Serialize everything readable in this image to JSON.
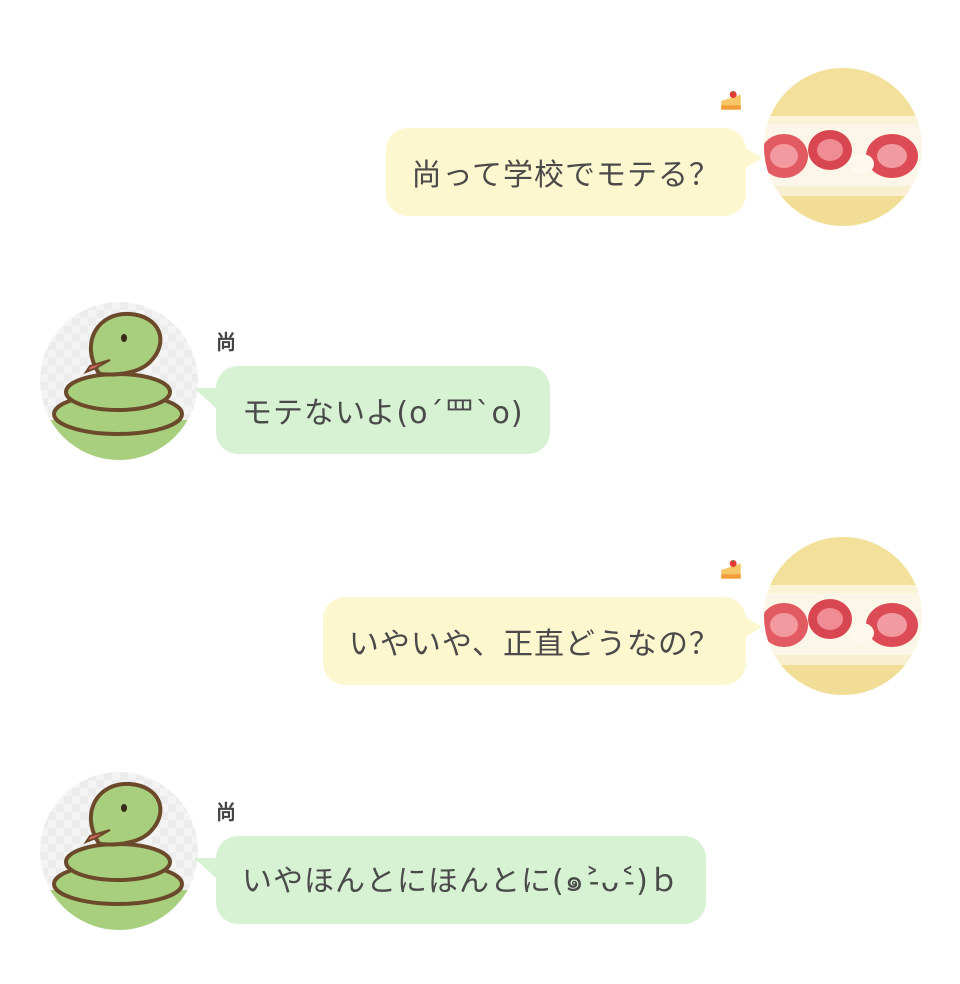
{
  "chat": {
    "messages": [
      {
        "direction": "outgoing",
        "text": "尚って学校でモテる？",
        "status_icon": "cake-icon"
      },
      {
        "direction": "incoming",
        "sender": "尚",
        "text": "モテないよ(o´罒`o)"
      },
      {
        "direction": "outgoing",
        "text": "いやいや、正直どうなの？",
        "status_icon": "cake-icon"
      },
      {
        "direction": "incoming",
        "sender": "尚",
        "text": "いやほんとにほんとに(๑˃̵ᴗ˂̵)ｂ"
      }
    ],
    "avatars": {
      "self": "strawberry-cake-avatar",
      "other": "snake-avatar"
    }
  },
  "colors": {
    "outgoing_bubble": "#fdf7cf",
    "incoming_bubble": "#d7f2d3",
    "text": "#4a4a4a"
  }
}
